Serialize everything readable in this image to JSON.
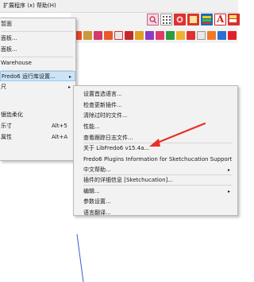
{
  "menubar": {
    "items": [
      "扩展程序 (x)",
      "帮助(H)"
    ]
  },
  "toolbar": {
    "text_icon_label": "A",
    "colors": {
      "red": "#e02020",
      "orange": "#f08a1c",
      "gold": "#c8a43a",
      "green": "#2e9b3e",
      "blue": "#2b6fd6",
      "purple": "#8a3cc8"
    }
  },
  "main_menu": {
    "items": [
      {
        "label": "暂面",
        "shortcut": "",
        "arrow": ""
      },
      {
        "label": "面板...",
        "shortcut": "",
        "arrow": ""
      },
      {
        "label": "面板...",
        "shortcut": "",
        "arrow": ""
      },
      {
        "label": "Warehouse",
        "shortcut": "",
        "arrow": ""
      },
      {
        "label": "Fredo6 运行库设置...",
        "shortcut": "",
        "arrow": "▸"
      },
      {
        "label": "尺",
        "shortcut": "",
        "arrow": "▸"
      },
      {
        "label": "锯齿柔化",
        "shortcut": "",
        "arrow": ""
      },
      {
        "label": "乐寸",
        "shortcut": "Alt+5",
        "arrow": ""
      },
      {
        "label": "属性",
        "shortcut": "Alt+A",
        "arrow": ""
      }
    ]
  },
  "submenu": {
    "items": [
      {
        "label": "设置首选语言...",
        "arrow": ""
      },
      {
        "label": "检查更新插件...",
        "arrow": ""
      },
      {
        "label": "清除过时的文件...",
        "arrow": ""
      },
      {
        "label": "性能...",
        "arrow": ""
      },
      {
        "label": "查看跟踪日志文件...",
        "arrow": ""
      },
      {
        "label": "关于 LibFredo6 v15.4a...",
        "arrow": ""
      },
      {
        "label": "Fredo6 Plugins Information for Sketchucation Support",
        "arrow": ""
      },
      {
        "label": "中文帮助...",
        "arrow": "▸"
      },
      {
        "label": "插件的详细信息 [Sketchucation]...",
        "arrow": ""
      },
      {
        "label": "编辑...",
        "arrow": "▸"
      },
      {
        "label": "参数设置...",
        "arrow": ""
      },
      {
        "label": "语言翻译...",
        "arrow": ""
      }
    ]
  },
  "annotation": {
    "color": "#e8312a"
  }
}
